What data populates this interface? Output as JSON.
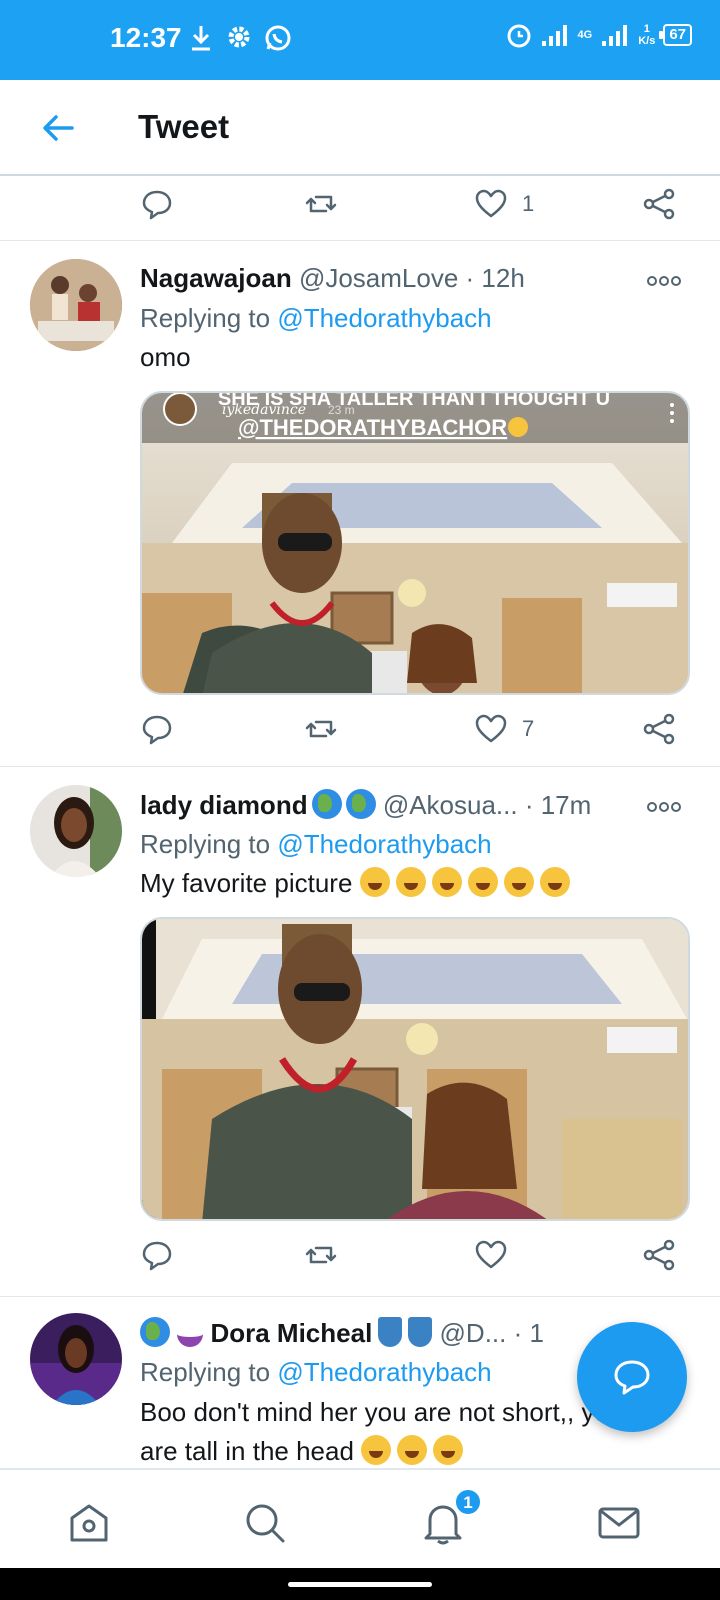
{
  "status_bar": {
    "time": "12:37",
    "network": "4G",
    "speed_value": "1",
    "speed_unit": "K/s",
    "battery": "67"
  },
  "header": {
    "title": "Tweet"
  },
  "top_actions": {
    "like_count": "1"
  },
  "tweets": [
    {
      "name": "Nagawajoan",
      "handle": "@JosamLove",
      "time": "· 12h",
      "replying_prefix": "Replying to",
      "replying_to": "@Thedorathybach",
      "text": "omo",
      "media_overlay_top": "SHE IS SHA TALLER THAN I THOUGHT U",
      "media_overlay_user": "iykedavince",
      "media_overlay_age": "23 m",
      "media_overlay_mention": "@THEDORATHYBACHOR",
      "like_count": "7"
    },
    {
      "name": "lady diamond",
      "handle": "@Akosua...",
      "time": "· 17m",
      "replying_prefix": "Replying to",
      "replying_to": "@Thedorathybach",
      "text": "My favorite picture",
      "like_count": ""
    },
    {
      "name": "Dora Micheal",
      "handle": "@D...",
      "time": "· 1",
      "replying_prefix": "Replying to",
      "replying_to": "@Thedorathybach",
      "text": "Boo don't mind her you are not short,, you",
      "text2": "are tall in the head"
    }
  ],
  "bottom_nav": {
    "notification_badge": "1"
  },
  "colors": {
    "accent": "#1d9bf0",
    "statusbar": "#1da1f2",
    "muted": "#536471"
  }
}
